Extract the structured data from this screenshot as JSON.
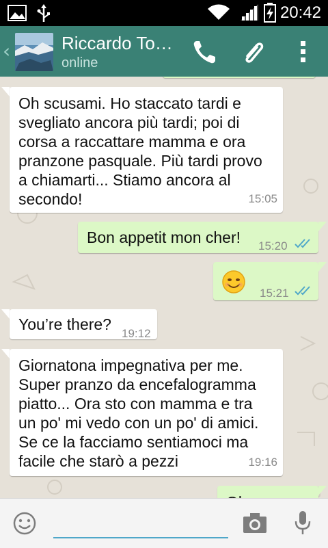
{
  "status_bar": {
    "time": "20:42"
  },
  "header": {
    "contact_name": "Riccardo To…",
    "contact_status": "online"
  },
  "messages": [
    {
      "text": "Oh scusami. Ho staccato tardi e\nsvegliato ancora più tardi; poi di\ncorsa a raccattare mamma e ora\npranzone pasquale. Più tardi provo\na chiamarti... Stiamo ancora al\nsecondo!",
      "time": "15:05"
    },
    {
      "text": "Bon appetit mon cher!",
      "time": "15:20"
    },
    {
      "emoji": "😊",
      "time": "15:21"
    },
    {
      "text": "You’re there?",
      "time": "19:12"
    },
    {
      "text": "Giornatona impegnativa per me.\nSuper pranzo da encefalogramma\npiatto... Ora sto con mamma e tra\nun po' mi vedo con un po' di amici.\nSe ce la facciamo sentiamoci ma\nfacile che starò a pezzi",
      "time": "19:16"
    },
    {
      "text": "Ok"
    }
  ],
  "input": {
    "placeholder": ""
  },
  "colors": {
    "header": "#3a8175",
    "incoming": "#ffffff",
    "outgoing": "#dcf8c6",
    "read_ticks": "#4fa7c9"
  }
}
